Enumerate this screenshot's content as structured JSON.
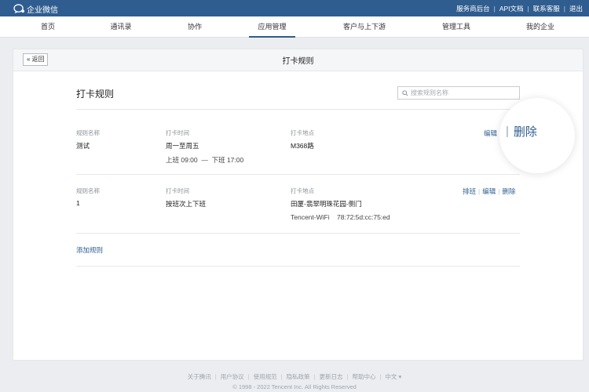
{
  "topbar": {
    "app_name": "企业微信",
    "links": [
      "服务商后台",
      "API文档",
      "联系客服",
      "退出"
    ]
  },
  "nav": {
    "items": [
      "首页",
      "通讯录",
      "协作",
      "应用管理",
      "客户与上下游",
      "管理工具",
      "我的企业"
    ],
    "active": "应用管理"
  },
  "page": {
    "back_label": "返回",
    "title": "打卡规则",
    "section_title": "打卡规则",
    "search_placeholder": "搜索规则名称"
  },
  "rules": [
    {
      "name_label": "规则名称",
      "name": "测试",
      "time_label": "打卡时间",
      "time": "周一至周五",
      "time_detail": "上班 09:00  —  下班 17:00",
      "place_label": "打卡地点",
      "place": "M368路",
      "place_detail": "",
      "actions": [
        "编辑",
        "删除"
      ]
    },
    {
      "name_label": "规则名称",
      "name": "1",
      "time_label": "打卡时间",
      "time": "按班次上下班",
      "time_detail": "",
      "place_label": "打卡地点",
      "place": "田厦-翡翠明珠花园-侧门",
      "place_detail": "Tencent-WiFi    78:72:5d:cc:75:ed",
      "actions": [
        "排班",
        "编辑",
        "删除"
      ]
    }
  ],
  "add_rule_label": "添加规则",
  "magnifier": {
    "label": "删除"
  },
  "footer": {
    "links": [
      "关于腾讯",
      "用户协议",
      "使用规范",
      "隐私政策",
      "更新日志",
      "帮助中心",
      "中文 ▾"
    ],
    "copyright": "© 1998 - 2022 Tencent Inc. All Rights Reserved"
  },
  "colors": {
    "topbar": "#2f5d8f",
    "link": "#2f5d8f",
    "background": "#ebedf0"
  }
}
